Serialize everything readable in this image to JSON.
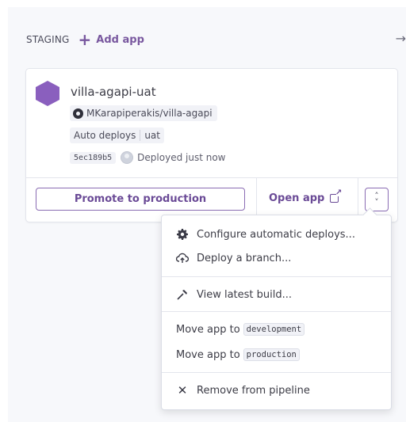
{
  "stage": {
    "name": "STAGING",
    "add_app_label": "Add app",
    "arrow_icon": "arrow-right-icon"
  },
  "app": {
    "name": "villa-agapi-uat",
    "repo": "MKarapiperakis/villa-agapi",
    "auto_deploys_label": "Auto deploys",
    "auto_deploys_branch": "uat",
    "commit_sha": "5ec189b5",
    "deploy_status": "Deployed just now",
    "hex_color": "#8a5fbe"
  },
  "footer": {
    "promote_label": "Promote to production",
    "open_app_label": "Open app"
  },
  "menu": {
    "configure_label": "Configure automatic deploys...",
    "deploy_branch_label": "Deploy a branch...",
    "view_build_label": "View latest build...",
    "move_prefix": "Move app to",
    "move_development": "development",
    "move_production": "production",
    "remove_label": "Remove from pipeline"
  },
  "colors": {
    "accent": "#79589f",
    "border": "#e3e5ec"
  }
}
